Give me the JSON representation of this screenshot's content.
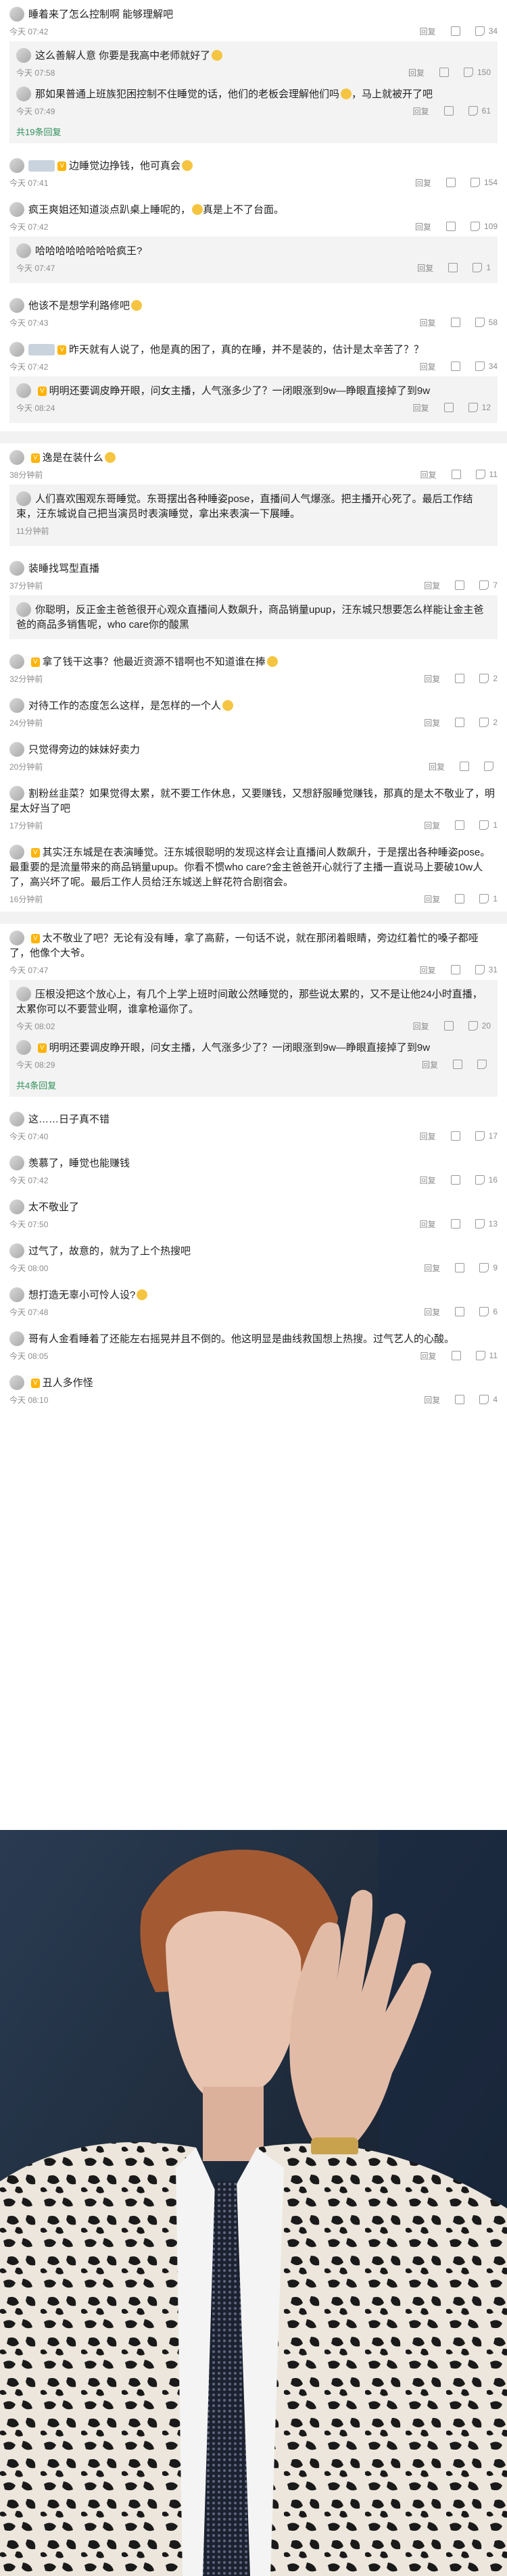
{
  "reply_label": "回复",
  "more_replies_19": "共19条回复",
  "more_replies_4": "共4条回复",
  "c1": {
    "text": "睡着来了怎么控制啊 能够理解吧",
    "time": "今天 07:42",
    "likes": "34"
  },
  "c1r1": {
    "text": "这么善解人意 你要是我高中老师就好了",
    "time": "今天 07:58",
    "likes": "150"
  },
  "c1r2": {
    "text": "那如果普通上班族犯困控制不住睡觉的话，他们的老板会理解他们吗",
    "text2": "马上就被开了吧",
    "time": "今天 07:49",
    "likes": "61"
  },
  "c2": {
    "text": "边睡觉边挣钱，他可真会",
    "time": "今天 07:41",
    "likes": "154"
  },
  "c3": {
    "text": "疯王爽姐还知道淡点趴桌上睡呢的，",
    "text2": "真是上不了台面。",
    "time": "今天 07:42",
    "likes": "109"
  },
  "c3r1": {
    "text": "哈哈哈哈哈哈哈哈疯王?",
    "time": "今天 07:47",
    "likes": "1"
  },
  "c4": {
    "text": "他该不是想学利路修吧",
    "time": "今天 07:43",
    "likes": "58"
  },
  "c5": {
    "text": "昨天就有人说了，他是真的困了，真的在睡，并不是装的，估计是太辛苦了？？",
    "time": "今天 07:42",
    "likes": "34"
  },
  "c5r1": {
    "text": "明明还要调皮睁开眼，问女主播，人气涨多少了？一闭眼涨到9w—睁眼直接掉了到9w",
    "time": "今天 08:24",
    "likes": "12"
  },
  "c6": {
    "text": "逸是在装什么",
    "time": "38分钟前",
    "likes": "11"
  },
  "c6r1": {
    "text": "人们喜欢围观东哥睡觉。东哥摆出各种睡姿pose，直播间人气爆涨。把主播开心死了。最后工作结束，汪东城说自己把当演员时表演睡觉，拿出来表演一下展睡。",
    "time": "11分钟前",
    "likes": ""
  },
  "c7": {
    "text": "装睡找骂型直播",
    "time": "37分钟前",
    "likes": "7"
  },
  "c7r1": {
    "text": "你聪明，反正金主爸爸很开心观众直播间人数飙升，商品销量upup，汪东城只想要怎么样能让金主爸爸的商品多销售呢，who care你的酸黑",
    "time": "",
    "likes": ""
  },
  "c8": {
    "text": "拿了钱干这事？他最近资源不错啊也不知道谁在捧",
    "time": "32分钟前",
    "likes": "2"
  },
  "c9": {
    "text": "对待工作的态度怎么这样，是怎样的一个人",
    "time": "24分钟前",
    "likes": "2"
  },
  "c10": {
    "text": "只觉得旁边的妹妹好卖力",
    "time": "20分钟前",
    "likes": ""
  },
  "c11": {
    "text": "割粉丝韭菜？如果觉得太累，就不要工作休息，又要赚钱，又想舒服睡觉赚钱，那真的是太不敬业了，明星太好当了吧",
    "time": "17分钟前",
    "likes": "1"
  },
  "c12": {
    "text": "其实汪东城是在表演睡觉。汪东城很聪明的发现这样会让直播间人数飙升，于是摆出各种睡姿pose。最重要的是流量带来的商品销量upup。你看不惯who care?金主爸爸开心就行了主播一直说马上要破10w人了，高兴坏了呢。最后工作人员给汪东城送上鲜花符合剧宿会。",
    "time": "16分钟前",
    "likes": "1"
  },
  "c13": {
    "text": "太不敬业了吧？无论有没有睡，拿了高薪，一句话不说，就在那闭着眼睛，旁边红着忙的嗓子都哑了，他像个大爷。",
    "time": "今天 07:47",
    "likes": "31"
  },
  "c13r1": {
    "text": "压根没把这个放心上，有几个上学上班时间敢公然睡觉的，那些说太累的，又不是让他24小时直播，太累你可以不要营业啊，谁拿枪逼你了。",
    "time": "今天 08:02",
    "likes": "20"
  },
  "c13r2": {
    "text": "明明还要调皮睁开眼，问女主播，人气涨多少了？一闭眼涨到9w—睁眼直接掉了到9w",
    "time": "今天 08:29",
    "likes": ""
  },
  "c14": {
    "text": "这……日子真不错",
    "time": "今天 07:40",
    "likes": "17"
  },
  "c15": {
    "text": "羡慕了，睡觉也能赚钱",
    "time": "今天 07:42",
    "likes": "16"
  },
  "c16": {
    "text": "太不敬业了",
    "time": "今天 07:50",
    "likes": "13"
  },
  "c17": {
    "text": "过气了，故意的，就为了上个热搜吧",
    "time": "今天 08:00",
    "likes": "9"
  },
  "c18": {
    "text": "想打造无辜小可怜人设?",
    "time": "今天 07:48",
    "likes": "6"
  },
  "c19": {
    "text": "哥有人金看睡着了还能左右摇晃并且不倒的。他这明显是曲线救国想上热搜。过气艺人的心酸。",
    "time": "今天 08:05",
    "likes": "11"
  },
  "c20": {
    "text": "丑人多作怪",
    "time": "今天 08:10",
    "likes": "4"
  }
}
